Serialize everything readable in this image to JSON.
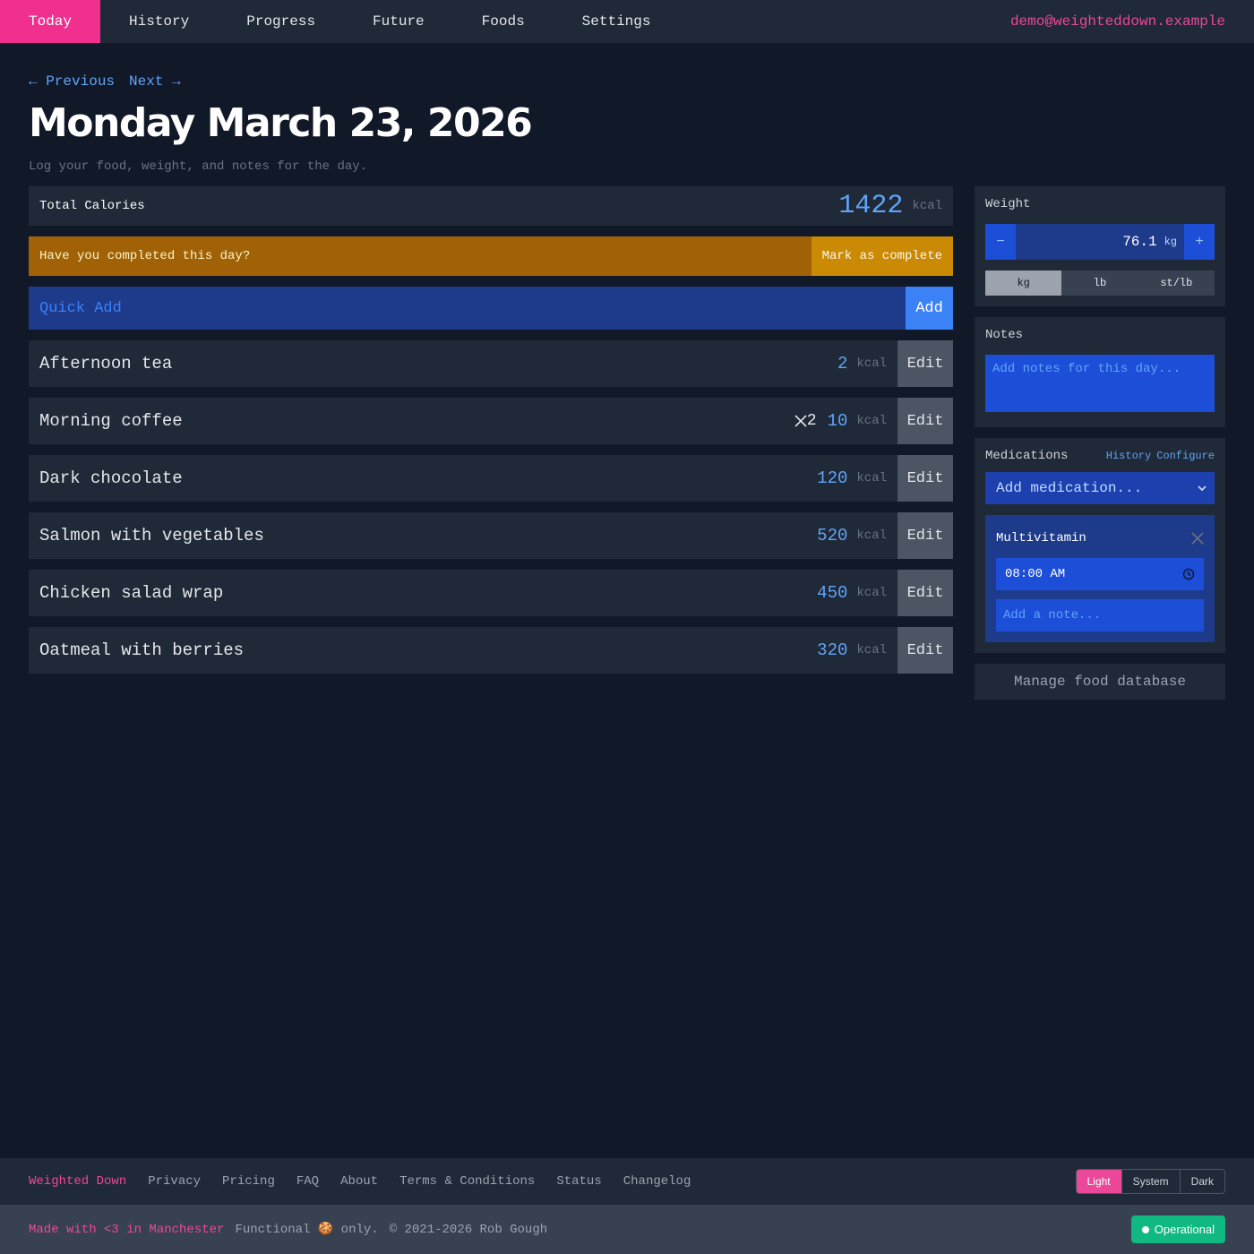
{
  "nav": {
    "tabs": [
      {
        "label": "Today",
        "active": true
      },
      {
        "label": "History",
        "active": false
      },
      {
        "label": "Progress",
        "active": false
      },
      {
        "label": "Future",
        "active": false
      },
      {
        "label": "Foods",
        "active": false
      },
      {
        "label": "Settings",
        "active": false
      }
    ],
    "user_email": "demo@weighteddown.example"
  },
  "day_nav": {
    "previous": "← Previous",
    "next": "Next →"
  },
  "page": {
    "title": "Monday March 23, 2026",
    "subtitle": "Log your food, weight, and notes for the day."
  },
  "total": {
    "label": "Total Calories",
    "value": "1422",
    "unit": "kcal"
  },
  "complete_prompt": {
    "question": "Have you completed this day?",
    "button": "Mark as complete"
  },
  "quick_add": {
    "placeholder": "Quick Add",
    "button": "Add"
  },
  "foods": [
    {
      "name": "Afternoon tea",
      "kcal": "2",
      "unit": "kcal",
      "multiplier": "",
      "edit": "Edit"
    },
    {
      "name": "Morning coffee",
      "kcal": "10",
      "unit": "kcal",
      "multiplier": "2",
      "edit": "Edit"
    },
    {
      "name": "Dark chocolate",
      "kcal": "120",
      "unit": "kcal",
      "multiplier": "",
      "edit": "Edit"
    },
    {
      "name": "Salmon with vegetables",
      "kcal": "520",
      "unit": "kcal",
      "multiplier": "",
      "edit": "Edit"
    },
    {
      "name": "Chicken salad wrap",
      "kcal": "450",
      "unit": "kcal",
      "multiplier": "",
      "edit": "Edit"
    },
    {
      "name": "Oatmeal with berries",
      "kcal": "320",
      "unit": "kcal",
      "multiplier": "",
      "edit": "Edit"
    }
  ],
  "weight": {
    "title": "Weight",
    "value": "76.1",
    "unit": "kg",
    "minus": "−",
    "plus": "+",
    "unit_options": [
      {
        "label": "kg",
        "active": true
      },
      {
        "label": "lb",
        "active": false
      },
      {
        "label": "st/lb",
        "active": false
      }
    ]
  },
  "notes": {
    "title": "Notes",
    "placeholder": "Add notes for this day..."
  },
  "medications": {
    "title": "Medications",
    "history_link": "History",
    "configure_link": "Configure",
    "select_placeholder": "Add medication...",
    "items": [
      {
        "name": "Multivitamin",
        "time": "08:00 AM",
        "note_placeholder": "Add a note..."
      }
    ]
  },
  "manage_foods": "Manage food database",
  "footer": {
    "brand": "Weighted Down",
    "links": [
      "Privacy",
      "Pricing",
      "FAQ",
      "About",
      "Terms & Conditions",
      "Status",
      "Changelog"
    ],
    "theme_options": [
      {
        "label": "Light",
        "active": true
      },
      {
        "label": "System",
        "active": false
      },
      {
        "label": "Dark",
        "active": false
      }
    ],
    "made_with": "Made with <3 in Manchester",
    "functional": "Functional 🍪 only.",
    "copyright": "© 2021-2026 Rob Gough",
    "status": "Operational"
  },
  "colors": {
    "accent_pink": "#f02f8f",
    "accent_blue": "#60a5fa",
    "background": "#111827",
    "panel": "#1f2937",
    "warning": "#a16207",
    "status_green": "#10b981"
  }
}
